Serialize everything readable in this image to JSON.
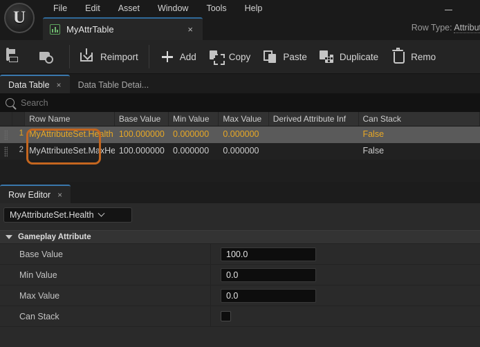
{
  "window": {
    "menus": [
      "File",
      "Edit",
      "Asset",
      "Window",
      "Tools",
      "Help"
    ],
    "minimize_label": "—",
    "logo_glyph": "U"
  },
  "asset_tab": {
    "name": "MyAttrTable",
    "close_label": "×",
    "icon": "data-table-icon"
  },
  "row_type": {
    "label": "Row Type:",
    "value": "Attribut"
  },
  "toolbar": {
    "save_label": "",
    "browse_label": "",
    "reimport_label": "Reimport",
    "add_label": "Add",
    "copy_label": "Copy",
    "paste_label": "Paste",
    "duplicate_label": "Duplicate",
    "remove_label": "Remo"
  },
  "panel_tabs": [
    {
      "label": "Data Table",
      "close_label": "×",
      "active": true
    },
    {
      "label": "Data Table Detai...",
      "close_label": "",
      "active": false
    }
  ],
  "search": {
    "placeholder": "Search",
    "value": "",
    "icon": "search-icon"
  },
  "table": {
    "columns": [
      "Row Name",
      "Base Value",
      "Min Value",
      "Max Value",
      "Derived Attribute Inf",
      "Can Stack"
    ],
    "rows": [
      {
        "index": "1",
        "row_name": "MyAttributeSet.Health",
        "base_value": "100.000000",
        "min_value": "0.000000",
        "max_value": "0.000000",
        "derived_attribute_info": "",
        "can_stack": "False",
        "selected": true
      },
      {
        "index": "2",
        "row_name": "MyAttributeSet.MaxHealth",
        "base_value": "100.000000",
        "min_value": "0.000000",
        "max_value": "0.000000",
        "derived_attribute_info": "",
        "can_stack": "False",
        "selected": false
      }
    ]
  },
  "annotation": {
    "color": "#c4661f",
    "shape": "rounded-rect-highlight"
  },
  "row_editor": {
    "tab_label": "Row Editor",
    "tab_close_label": "×",
    "selected_row": "MyAttributeSet.Health",
    "category": "Gameplay Attribute",
    "properties": [
      {
        "label": "Base Value",
        "value": "100.0",
        "type": "text"
      },
      {
        "label": "Min Value",
        "value": "0.0",
        "type": "text"
      },
      {
        "label": "Max Value",
        "value": "0.0",
        "type": "text"
      },
      {
        "label": "Can Stack",
        "value": "",
        "type": "checkbox",
        "checked": false
      }
    ]
  },
  "colors": {
    "accent_selection_text": "#e8a825",
    "annotation": "#c4661f",
    "tab_accent": "#3a78ad",
    "asset_icon": "#6fba6f"
  }
}
